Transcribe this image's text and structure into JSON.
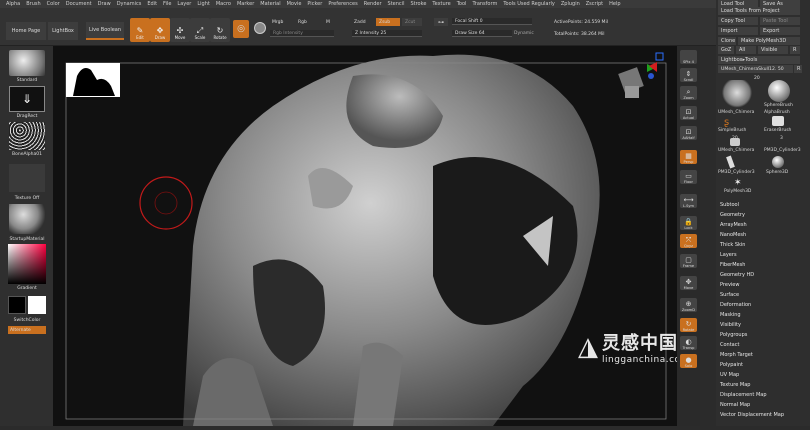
{
  "menu": [
    "Alpha",
    "Brush",
    "Color",
    "Document",
    "Draw",
    "Dynamics",
    "Edit",
    "File",
    "Layer",
    "Light",
    "Macro",
    "Marker",
    "Material",
    "Movie",
    "Picker",
    "Preferences",
    "Render",
    "Stencil",
    "Stroke",
    "Texture",
    "Tool",
    "Transform",
    "Tools Used Regularly",
    "Zplugin",
    "Zscript",
    "Help"
  ],
  "tabs": {
    "home": "Home Page",
    "lightbox": "LightBox",
    "live_boolean": "Live Boolean"
  },
  "tools": [
    {
      "name": "Edit",
      "icon": "✎"
    },
    {
      "name": "Draw",
      "icon": "✥"
    },
    {
      "name": "Move",
      "icon": "✣"
    },
    {
      "name": "Scale",
      "icon": "⤢"
    },
    {
      "name": "Rotate",
      "icon": "↻"
    }
  ],
  "mrgb": {
    "mrgb": "Mrgb",
    "rgb": "Rgb",
    "m": "M",
    "rgb_intensity": "Rgb Intensity"
  },
  "z": {
    "zadd": "Zadd",
    "zsub": "Zsub",
    "zcut": "Zcut",
    "z_intensity": "Z Intensity 25"
  },
  "focal": {
    "focal_shift": "Focal Shift 0",
    "draw_size": "Draw Size 64",
    "dynamic": "Dynamic"
  },
  "points": {
    "active": "ActivePoints: 24.559 Mil",
    "total": "TotalPoints: 38.264 Mil"
  },
  "right_top": {
    "load_tool": "Load Tool",
    "save_as": "Save As",
    "load_from_project": "Load Tools From Project",
    "copy_tool": "Copy Tool",
    "paste_tool": "Paste Tool",
    "import": "Import",
    "export": "Export",
    "clone": "Clone",
    "make_polymesh": "Make PolyMesh3D",
    "goz": "GoZ",
    "all": "All",
    "visible": "Visible",
    "r": "R",
    "lightbox_tools": "Lightbox▸Tools",
    "mesh_name": "UMesh_ChimeraSkull12. 50",
    "r2": "R"
  },
  "right_thumbs": [
    {
      "label": "UMesh_Chimera"
    },
    {
      "label": "SphereBrush"
    },
    {
      "label": "AlphaBrush"
    },
    {
      "label": "SimpleBrush"
    },
    {
      "label": "EraserBrush"
    },
    {
      "label": "UMesh_Chimera"
    },
    {
      "label": "PM3D_Cylinder3"
    },
    {
      "label": "PM3D_Cylinder3"
    },
    {
      "label": "Sphere3D"
    },
    {
      "label": "PolyMesh3D"
    }
  ],
  "thumb_counts": {
    "c1": "20",
    "c2": "20",
    "c3": "3"
  },
  "right_menu": [
    "Subtool",
    "Geometry",
    "ArrayMesh",
    "NanoMesh",
    "Thick Skin",
    "Layers",
    "FiberMesh",
    "Geometry HD",
    "Preview",
    "Surface",
    "Deformation",
    "Masking",
    "Visibility",
    "Polygroups",
    "Contact",
    "Morph Target",
    "Polypaint",
    "UV Map",
    "Texture Map",
    "Displacement Map",
    "Normal Map",
    "Vector Displacement Map"
  ],
  "left": {
    "standard": "Standard",
    "dragrect": "DragRect",
    "bonealpha": "BoneAlpha01",
    "texture_off": "Texture Off",
    "startup_material": "StartupMaterial",
    "gradient": "Gradient",
    "switch_color": "SwitchColor",
    "alternate": "Alternate"
  },
  "strip": [
    {
      "name": "SPix 4",
      "icon": ""
    },
    {
      "name": "Scroll",
      "icon": "⇕"
    },
    {
      "name": "Zoom",
      "icon": "⌕"
    },
    {
      "name": "Actual",
      "icon": "⊡"
    },
    {
      "name": "AAHalf",
      "icon": "⊡"
    },
    {
      "name": "Persp",
      "icon": "▦"
    },
    {
      "name": "Floor",
      "icon": "▭"
    },
    {
      "name": "L.Sym",
      "icon": "⟷"
    },
    {
      "name": "Lock",
      "icon": "🔒"
    },
    {
      "name": "Qxyz",
      "icon": "⤧"
    },
    {
      "name": "Frame",
      "icon": "▢"
    },
    {
      "name": "Move",
      "icon": "✥"
    },
    {
      "name": "ZoomD",
      "icon": "⊕"
    },
    {
      "name": "Rotate",
      "icon": "↻"
    },
    {
      "name": "Transp",
      "icon": "◐"
    },
    {
      "name": "Solo",
      "icon": "●"
    }
  ],
  "watermark": {
    "brand": "灵感中国",
    "url": "lingganchina.com"
  },
  "colors": {
    "accent": "#c9701f",
    "panel": "#2e2e2e",
    "canvas": "#111111"
  }
}
